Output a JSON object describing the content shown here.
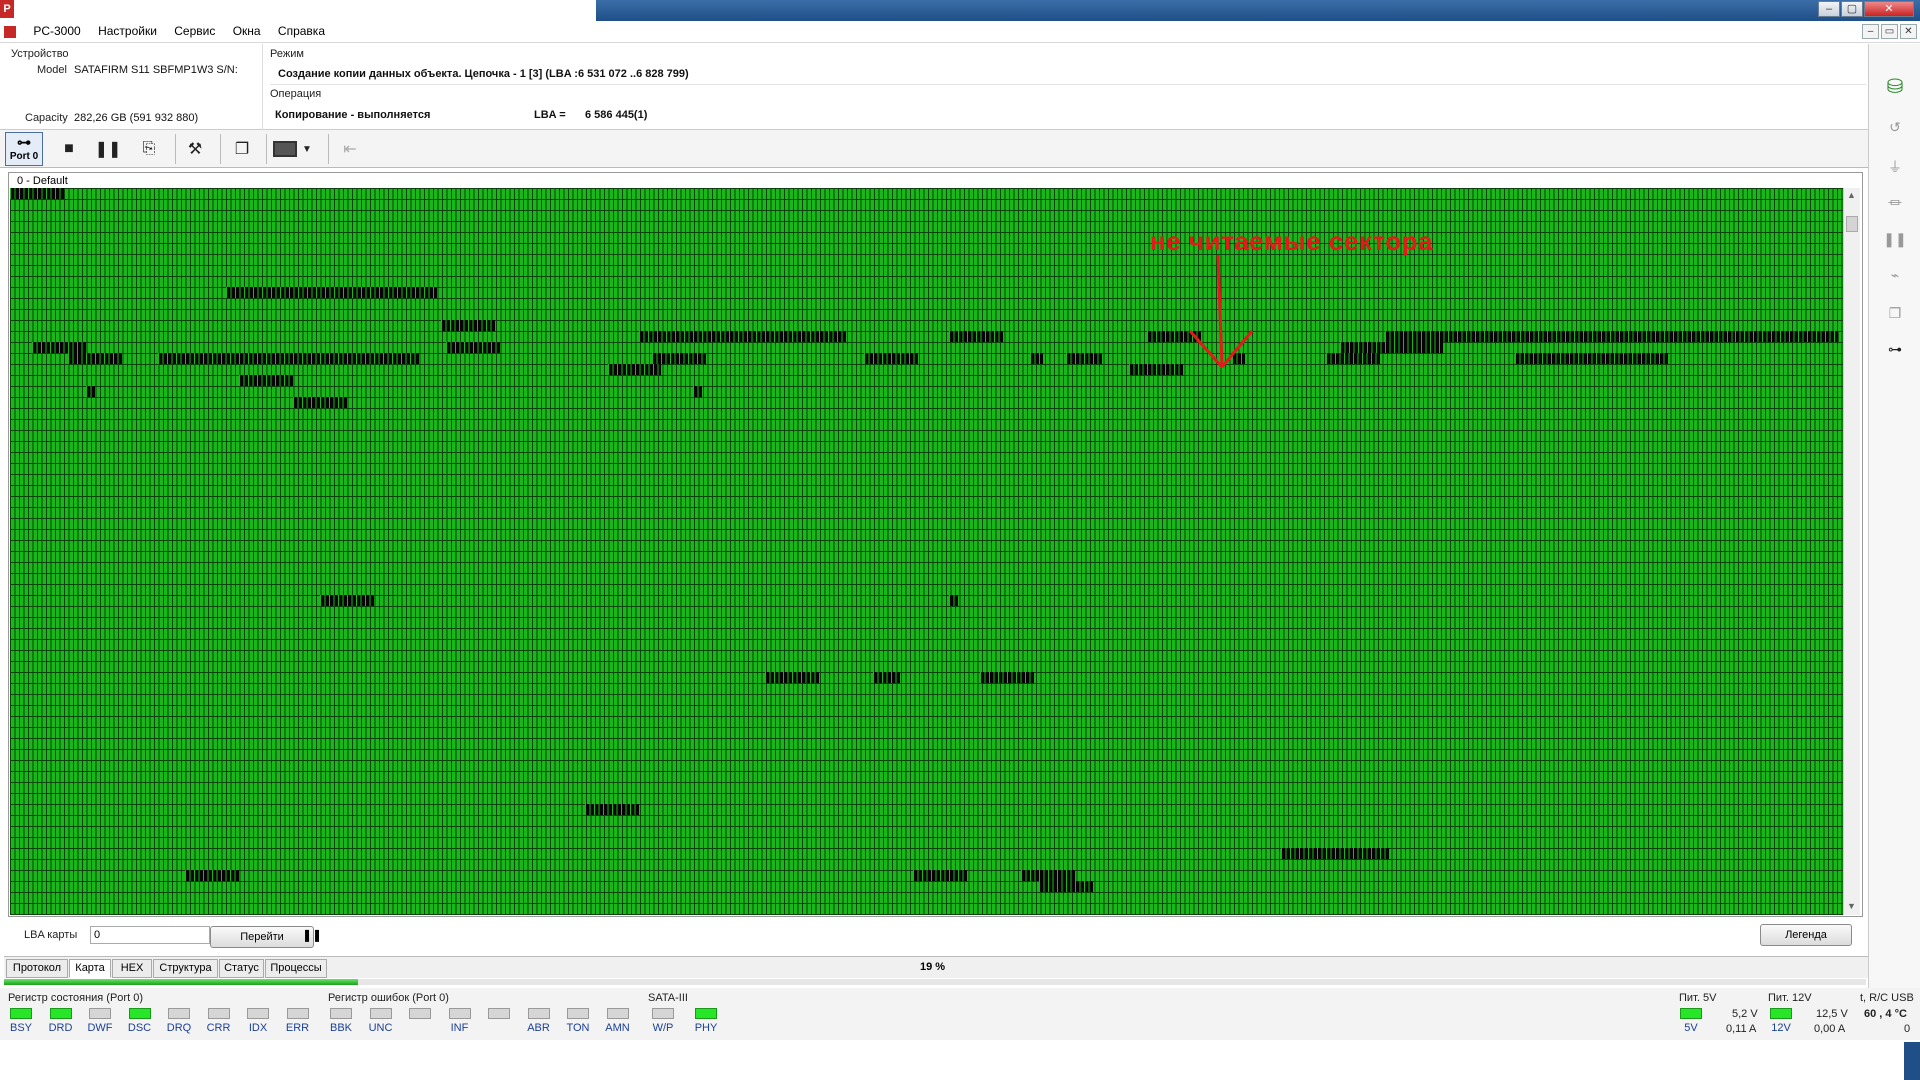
{
  "title_bar": {
    "icon_text": "P"
  },
  "menu": {
    "items": [
      "PC-3000",
      "Настройки",
      "Сервис",
      "Окна",
      "Справка"
    ]
  },
  "device": {
    "section_label": "Устройство",
    "model_label": "Model",
    "model_value": "SATAFIRM   S11 SBFMP1W3 S/N:",
    "capacity_label": "Capacity",
    "capacity_value": "282,26 GB (591 932 880)"
  },
  "mode": {
    "section_label": "Режим",
    "value": "Создание копии данных объекта. Цепочка - 1 [3] (LBA :6 531 072 ..6 828 799)"
  },
  "operation": {
    "section_label": "Операция",
    "value": "Копирование - выполняется",
    "lba_label": "LBA =",
    "lba_value": "6 586 445(1)"
  },
  "toolbar": {
    "port_label": "Port 0"
  },
  "map": {
    "title": "0 - Default",
    "annotation": "не читаемые сектора",
    "bad_color": "#050505",
    "good_color": "#19b719"
  },
  "controls": {
    "lba_map_label": "LBA карты",
    "lba_map_value": "0",
    "goto_label": "Перейти",
    "legend_label": "Легенда",
    "progress_text": "19 %",
    "progress_fraction": 0.19
  },
  "tabs": [
    "Протокол",
    "Карта",
    "HEX",
    "Структура",
    "Статус",
    "Процессы"
  ],
  "status_register": {
    "title": "Регистр состояния (Port 0)",
    "leds": [
      {
        "label": "BSY",
        "on": true
      },
      {
        "label": "DRD",
        "on": true
      },
      {
        "label": "DWF",
        "on": false
      },
      {
        "label": "DSC",
        "on": true
      },
      {
        "label": "DRQ",
        "on": false
      },
      {
        "label": "CRR",
        "on": false
      },
      {
        "label": "IDX",
        "on": false
      },
      {
        "label": "ERR",
        "on": false
      }
    ]
  },
  "error_register": {
    "title": "Регистр ошибок (Port 0)",
    "leds": [
      {
        "label": "BBK",
        "on": false
      },
      {
        "label": "UNC",
        "on": false
      },
      {
        "label": "",
        "on": false
      },
      {
        "label": "INF",
        "on": false
      },
      {
        "label": "",
        "on": false
      },
      {
        "label": "ABR",
        "on": false
      },
      {
        "label": "TON",
        "on": false
      },
      {
        "label": "AMN",
        "on": false
      }
    ]
  },
  "sata": {
    "title": "SATA-III",
    "leds": [
      {
        "label": "W/P",
        "on": false
      },
      {
        "label": "PHY",
        "on": true
      }
    ]
  },
  "power5": {
    "title": "Пит. 5V",
    "led_label": "5V",
    "voltage": "5,2 V",
    "current": "0,11 A"
  },
  "power12": {
    "title": "Пит. 12V",
    "led_label": "12V",
    "voltage": "12,5 V",
    "current": "0,00 A"
  },
  "temp": {
    "title": "t, R/C USB",
    "value": "60 , 4 °C",
    "extra": "0"
  }
}
